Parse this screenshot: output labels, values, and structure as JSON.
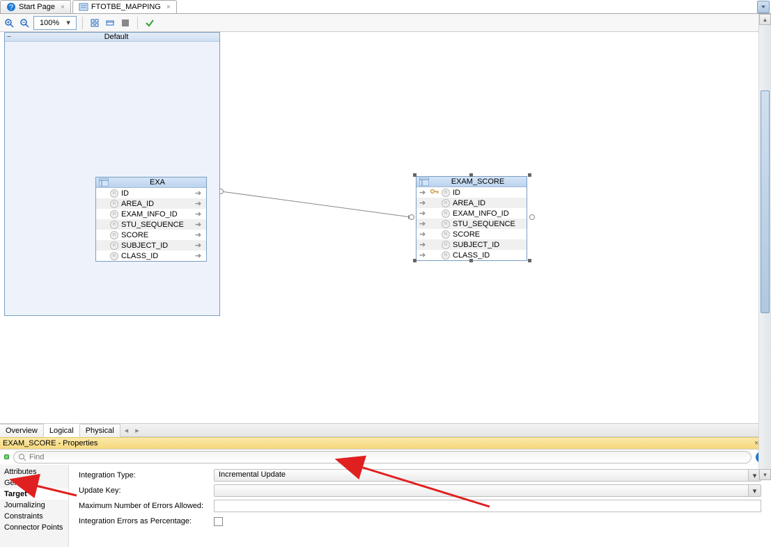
{
  "tabs": [
    {
      "label": "Start Page",
      "icon": "help"
    },
    {
      "label": "FTOTBE_MAPPING",
      "icon": "mapping",
      "active": true
    }
  ],
  "toolbar": {
    "zoom": "100%"
  },
  "canvas": {
    "default_label": "Default",
    "source": {
      "title": "EXA",
      "columns": [
        "ID",
        "AREA_ID",
        "EXAM_INFO_ID",
        "STU_SEQUENCE",
        "SCORE",
        "SUBJECT_ID",
        "CLASS_ID"
      ]
    },
    "target": {
      "title": "EXAM_SCORE",
      "columns": [
        "ID",
        "AREA_ID",
        "EXAM_INFO_ID",
        "STU_SEQUENCE",
        "SCORE",
        "SUBJECT_ID",
        "CLASS_ID"
      ]
    }
  },
  "subtabs": [
    "Overview",
    "Logical",
    "Physical"
  ],
  "properties": {
    "title": "EXAM_SCORE - Properties",
    "find_placeholder": "Find",
    "sidebar": [
      "Attributes",
      "General",
      "Target",
      "Journalizing",
      "Constraints",
      "Connector Points"
    ],
    "active_sidebar_index": 2,
    "form": {
      "integration_type_label": "Integration Type:",
      "integration_type_value": "Incremental Update",
      "update_key_label": "Update Key:",
      "update_key_value": "",
      "max_errors_label": "Maximum Number of Errors Allowed:",
      "max_errors_value": "",
      "errors_pct_label": "Integration Errors as Percentage:",
      "errors_pct_checked": false
    }
  }
}
